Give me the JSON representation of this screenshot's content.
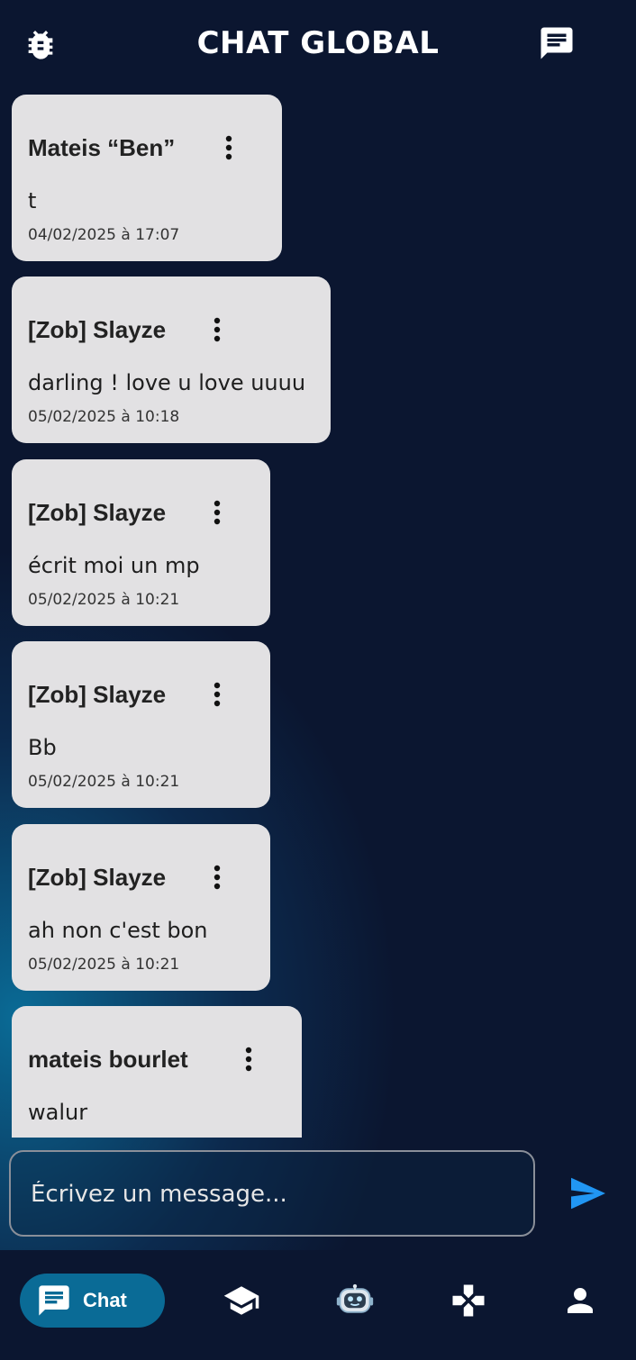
{
  "header": {
    "title": "CHAT GLOBAL"
  },
  "messages": [
    {
      "author": "Mateis “Ben”",
      "text": "t",
      "date": "04/02/2025 à 17:07"
    },
    {
      "author": "[Zob] Slayze",
      "text": "darling ! love u love uuuu",
      "date": "05/02/2025 à 10:18"
    },
    {
      "author": "[Zob] Slayze",
      "text": "écrit moi un mp",
      "date": "05/02/2025 à 10:21"
    },
    {
      "author": "[Zob] Slayze",
      "text": "Bb",
      "date": "05/02/2025 à 10:21"
    },
    {
      "author": "[Zob] Slayze",
      "text": "ah non c'est bon",
      "date": "05/02/2025 à 10:21"
    },
    {
      "author": "mateis bourlet",
      "text": "walur",
      "date": ""
    }
  ],
  "composer": {
    "placeholder": "Écrivez un message..."
  },
  "nav": {
    "active_label": "Chat",
    "items": [
      "chat-icon",
      "school-icon",
      "robot-icon",
      "gamepad-icon",
      "person-icon"
    ]
  },
  "colors": {
    "background": "#0b1630",
    "accent": "#0a6b96",
    "send": "#2196f3",
    "card": "#e2e1e3"
  }
}
